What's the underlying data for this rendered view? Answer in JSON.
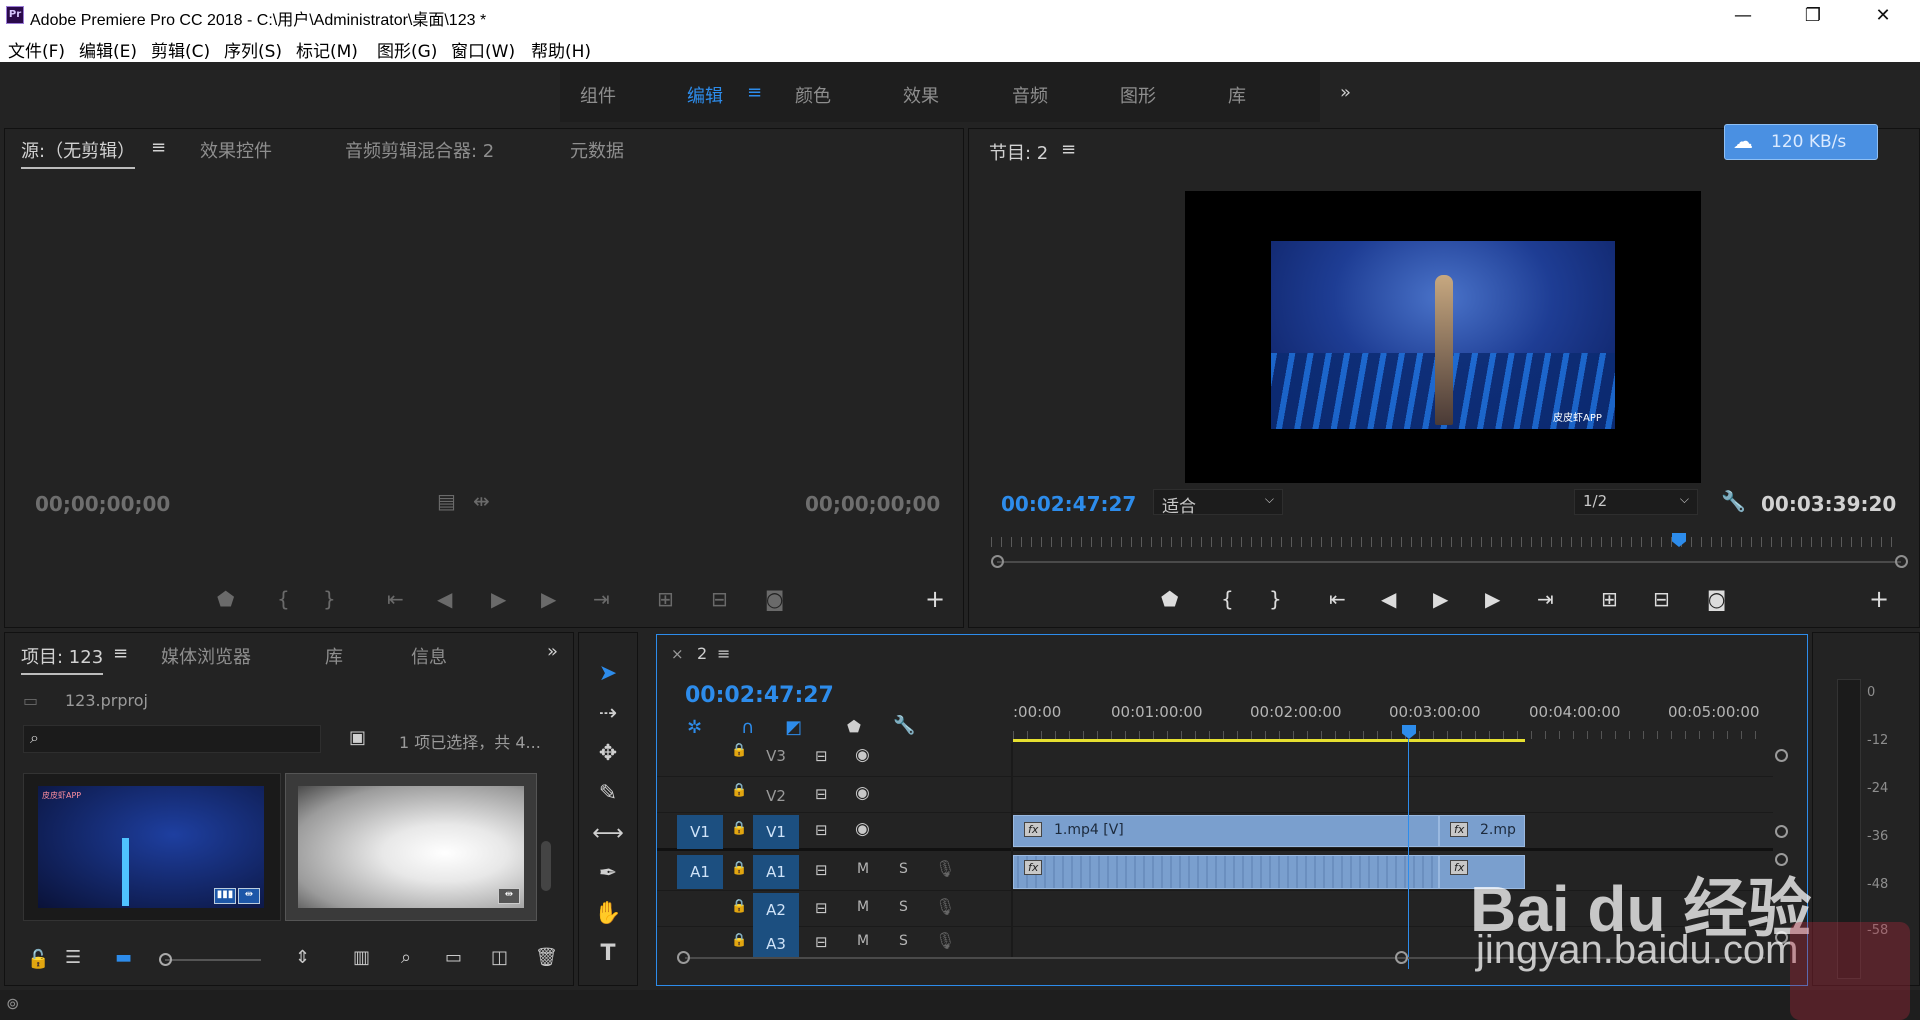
{
  "window": {
    "app_icon": "Pr",
    "title": "Adobe Premiere Pro CC 2018 - C:\\用户\\Administrator\\桌面\\123 *",
    "minimize": "—",
    "restore": "❐",
    "close": "✕"
  },
  "menu": [
    "文件(F)",
    "编辑(E)",
    "剪辑(C)",
    "序列(S)",
    "标记(M)",
    "图形(G)",
    "窗口(W)",
    "帮助(H)"
  ],
  "workspaces": {
    "tabs": [
      "组件",
      "编辑",
      "颜色",
      "效果",
      "音频",
      "图形",
      "库"
    ],
    "active": "编辑",
    "menu_glyph": "≡",
    "more": "»"
  },
  "source_panel": {
    "tabs": [
      "源:（无剪辑）",
      "效果控件",
      "音频剪辑混合器: 2",
      "元数据"
    ],
    "menu_glyph": "≡",
    "timecode_in": "00;00;00;00",
    "timecode_out": "00;00;00;00",
    "add": "+"
  },
  "program_panel": {
    "tab": "节目: 2",
    "menu_glyph": "≡",
    "timecode": "00:02:47:27",
    "fit": "适合",
    "resolution": "1/2",
    "duration": "00:03:39:20",
    "watermark": "皮皮虾APP",
    "add": "+"
  },
  "speed_badge": {
    "text": "120 KB/s",
    "icon": "cloud-icon"
  },
  "project_panel": {
    "tabs": [
      "项目: 123",
      "媒体浏览器",
      "库",
      "信息"
    ],
    "menu_glyph": "≡",
    "more": "»",
    "file": "123.prproj",
    "search_placeholder": "",
    "selection_info": "1 项已选择，共 4...",
    "thumb1_watermark": "皮皮虾APP"
  },
  "timeline": {
    "close": "×",
    "sequence": "2",
    "menu_glyph": "≡",
    "timecode": "00:02:47:27",
    "ruler": [
      ":00:00",
      "00:01:00:00",
      "00:02:00:00",
      "00:03:00:00",
      "00:04:00:00",
      "00:05:00:00"
    ],
    "tracks": [
      {
        "source": "",
        "name": "V3",
        "type": "video"
      },
      {
        "source": "",
        "name": "V2",
        "type": "video"
      },
      {
        "source": "V1",
        "name": "V1",
        "type": "video"
      },
      {
        "source": "A1",
        "name": "A1",
        "type": "audio"
      },
      {
        "source": "",
        "name": "A2",
        "type": "audio"
      },
      {
        "source": "",
        "name": "A3",
        "type": "audio"
      }
    ],
    "mute": "M",
    "solo": "S",
    "clip1": "1.mp4 [V]",
    "clip2": "2.mp",
    "fx": "fx"
  },
  "meters": {
    "scale": [
      "0",
      "-12",
      "-24",
      "-36",
      "-48",
      "-58"
    ]
  },
  "overlay": {
    "brand": "Bai du 经验",
    "url": "jingyan.baidu.com"
  }
}
